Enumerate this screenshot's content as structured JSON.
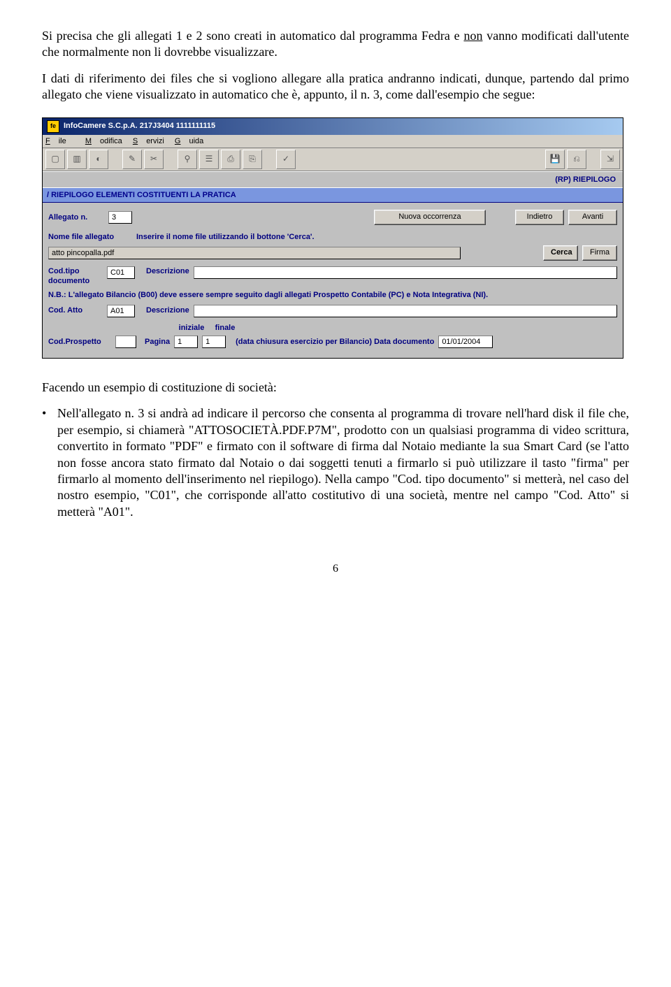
{
  "para1_a": "Si precisa che gli allegati 1 e 2 sono creati in automatico dal programma Fedra e ",
  "para1_b": "non",
  "para1_c": " vanno modificati dall'utente che normalmente non li dovrebbe visualizzare.",
  "para2": "I dati di riferimento dei files che si vogliono allegare alla pratica andranno indicati, dunque, partendo dal primo allegato che viene visualizzato in automatico che è, appunto, il n. 3, come dall'esempio che segue:",
  "app": {
    "title": "InfoCamere S.C.p.A. 217J3404 1111111115",
    "menu": {
      "file": "File",
      "modifica": "Modifica",
      "servizi": "Servizi",
      "guida": "Guida"
    },
    "rp_label": "(RP)  RIEPILOGO",
    "section": "/ RIEPILOGO ELEMENTI COSTITUENTI LA PRATICA",
    "allegato_label": "Allegato n.",
    "allegato_value": "3",
    "btn_nuova": "Nuova occorrenza",
    "btn_indietro": "Indietro",
    "btn_avanti": "Avanti",
    "nomefile_label": "Nome file allegato",
    "nomefile_hint": "Inserire il nome file utilizzando il bottone 'Cerca'.",
    "nomefile_value": "atto pincopalla.pdf",
    "btn_cerca": "Cerca",
    "btn_firma": "Firma",
    "codtipo_label1": "Cod.tipo",
    "codtipo_label2": "documento",
    "codtipo_value": "C01",
    "descr_label": "Descrizione",
    "nb": "N.B.: L'allegato Bilancio (B00) deve essere sempre seguito dagli allegati Prospetto Contabile (PC) e Nota Integrativa (NI).",
    "codatto_label": "Cod. Atto",
    "codatto_value": "A01",
    "iniziale": "iniziale",
    "finale": "finale",
    "codprospetto_label": "Cod.Prospetto",
    "pagina_label": "Pagina",
    "pagina_i": "1",
    "pagina_f": "1",
    "datachius": "(data chiusura esercizio per Bilancio) Data documento",
    "data_value": "01/01/2004"
  },
  "para3": "Facendo un esempio di costituzione di società:",
  "bullet": "Nell'allegato n. 3 si andrà ad indicare il percorso che consenta al programma di trovare nell'hard disk il file che, per esempio, si chiamerà \"ATTOSOCIETÀ.PDF.P7M\", prodotto con un qualsiasi programma di video scrittura, convertito in formato \"PDF\" e firmato con il software di firma dal Notaio mediante la sua Smart Card (se l'atto non fosse ancora stato firmato dal Notaio o dai soggetti tenuti a firmarlo si può utilizzare il tasto \"firma\" per firmarlo al momento dell'inserimento nel riepilogo). Nella campo \"Cod. tipo documento\" si metterà, nel caso del nostro esempio, \"C01\", che corrisponde all'atto costitutivo di una società, mentre nel campo \"Cod. Atto\" si metterà \"A01\".",
  "page_num": "6"
}
